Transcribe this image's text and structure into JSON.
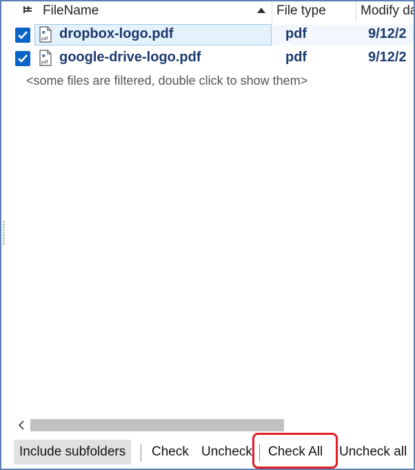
{
  "header": {
    "col_filename": "FileName",
    "col_filetype": "File type",
    "col_modify": "Modify da"
  },
  "files": [
    {
      "name": "dropbox-logo.pdf",
      "type": "pdf",
      "modified": "9/12/2",
      "checked": true,
      "selected": true
    },
    {
      "name": "google-drive-logo.pdf",
      "type": "pdf",
      "modified": "9/12/2",
      "checked": true,
      "selected": false
    }
  ],
  "filter_message": "<some files are filtered, double click to show them>",
  "toolbar": {
    "include_subfolders": "Include subfolders",
    "check": "Check",
    "uncheck": "Uncheck",
    "check_all": "Check All",
    "uncheck_all": "Uncheck all"
  },
  "colors": {
    "accent": "#0a64c8",
    "highlight_border": "#e31b23",
    "selection": "#e5f1fb",
    "text_file": "#1c3a6e"
  },
  "icons": {
    "pin": "pin-icon",
    "sort": "sort-ascending-icon",
    "file": "pdf-file-icon",
    "check": "checkmark-icon",
    "scroll_left": "chevron-left-icon"
  }
}
